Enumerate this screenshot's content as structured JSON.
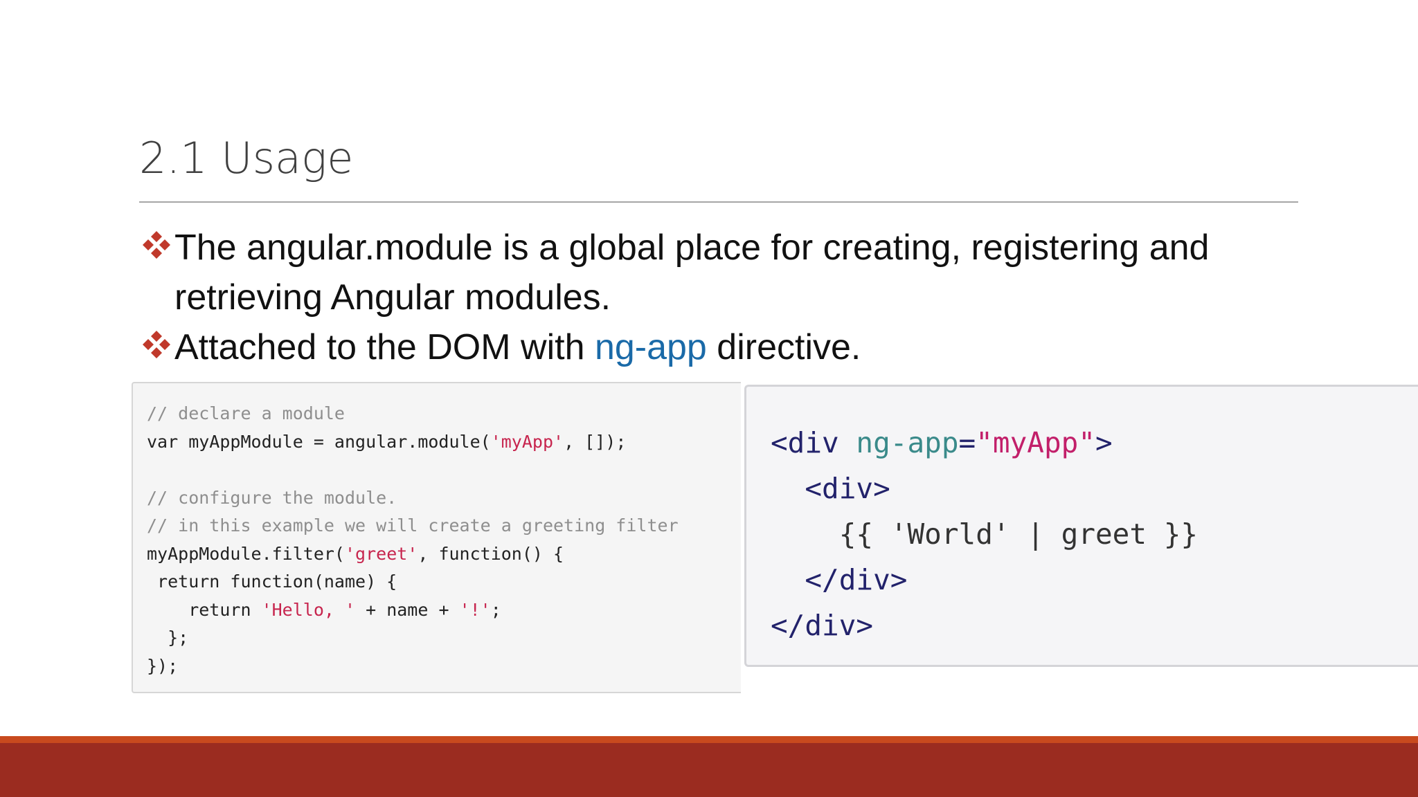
{
  "slide": {
    "title": "2.1 Usage",
    "bullet_marker_icon": "four-diamond-bullet-icon",
    "bullet_marker_color": "#c0392b",
    "bullets": [
      {
        "line1": "The angular.module is a global place for creating, registering and",
        "line2": "retrieving Angular modules."
      },
      {
        "before": "Attached to the DOM with ",
        "highlight": "ng-app",
        "after": " directive."
      }
    ],
    "accent_color": "#1a6aa8"
  },
  "code_js": {
    "line1": "// declare a module",
    "line2_a": "var myAppModule = angular.module(",
    "line2_str": "'myApp'",
    "line2_b": ", []);",
    "line3": "",
    "line4": "// configure the module.",
    "line5": "// in this example we will create a greeting filter",
    "line6_a": "myAppModule.filter(",
    "line6_str": "'greet'",
    "line6_b": ", function() {",
    "line7": " return function(name) {",
    "line8_a": "    return ",
    "line8_str1": "'Hello, '",
    "line8_b": " + name + ",
    "line8_str2": "'!'",
    "line8_c": ";",
    "line9": "  };",
    "line10": "});"
  },
  "code_html": {
    "l1_open": "<div ",
    "l1_attr": "ng-app",
    "l1_eq": "=",
    "l1_str": "\"myApp\"",
    "l1_close": ">",
    "l2": "  <div>",
    "l3": "    {{ 'World' | greet }}",
    "l4": "  </div>",
    "l5": "</div>"
  },
  "footer": {
    "thin_color": "#c84a1e",
    "band_color": "#9b2c20"
  }
}
